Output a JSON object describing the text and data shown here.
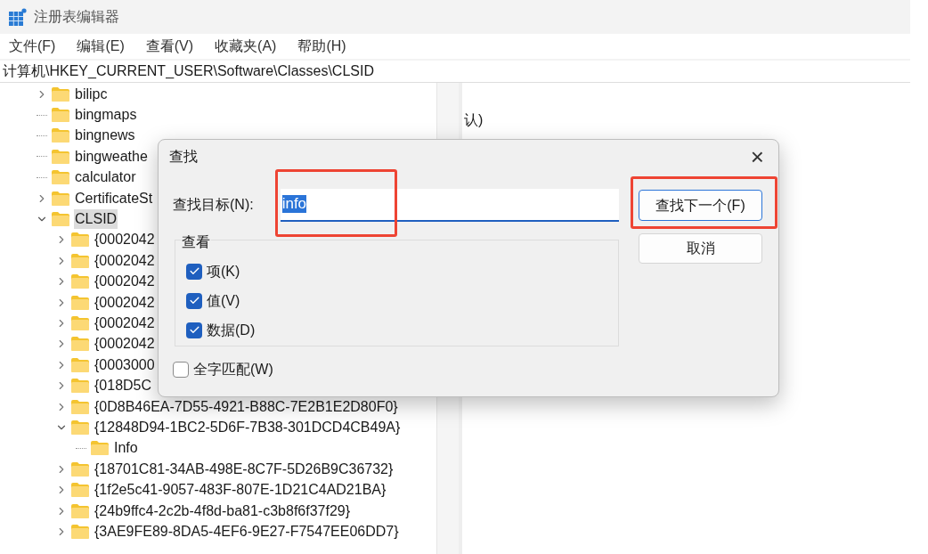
{
  "window": {
    "title": "注册表编辑器"
  },
  "menu": [
    "文件(F)",
    "编辑(E)",
    "查看(V)",
    "收藏夹(A)",
    "帮助(H)"
  ],
  "address": "计算机\\HKEY_CURRENT_USER\\Software\\Classes\\CLSID",
  "tree": [
    {
      "label": "bilipc",
      "kind": "branch",
      "expanded": false,
      "selected": false
    },
    {
      "label": "bingmaps",
      "kind": "leaf",
      "selected": false
    },
    {
      "label": "bingnews",
      "kind": "leaf",
      "selected": false
    },
    {
      "label": "bingweathe",
      "kind": "leaf",
      "selected": false
    },
    {
      "label": "calculator",
      "kind": "leaf",
      "selected": false
    },
    {
      "label": "CertificateSt",
      "kind": "branch",
      "expanded": false,
      "selected": false
    },
    {
      "label": "CLSID",
      "kind": "branch",
      "expanded": true,
      "selected": true,
      "children": [
        {
          "label": "{0002042",
          "kind": "branch",
          "expanded": false,
          "selected": false
        },
        {
          "label": "{0002042",
          "kind": "branch",
          "expanded": false,
          "selected": false
        },
        {
          "label": "{0002042",
          "kind": "branch",
          "expanded": false,
          "selected": false
        },
        {
          "label": "{0002042",
          "kind": "branch",
          "expanded": false,
          "selected": false
        },
        {
          "label": "{0002042",
          "kind": "branch",
          "expanded": false,
          "selected": false
        },
        {
          "label": "{0002042",
          "kind": "branch",
          "expanded": false,
          "selected": false
        },
        {
          "label": "{0003000",
          "kind": "branch",
          "expanded": false,
          "selected": false
        },
        {
          "label": "{018D5C",
          "kind": "branch",
          "expanded": false,
          "selected": false
        },
        {
          "label": "{0D8B46EA-7D55-4921-B88C-7E2B1E2D80F0}",
          "kind": "branch",
          "expanded": false,
          "selected": false
        },
        {
          "label": "{12848D94-1BC2-5D6F-7B38-301DCD4CB49A}",
          "kind": "branch",
          "expanded": true,
          "selected": false,
          "children": [
            {
              "label": "Info",
              "kind": "leaf",
              "selected": false
            }
          ]
        },
        {
          "label": "{18701C81-34AB-498E-8C7F-5D26B9C36732}",
          "kind": "branch",
          "expanded": false,
          "selected": false
        },
        {
          "label": "{1f2e5c41-9057-483F-807E-1D21C4AD21BA}",
          "kind": "branch",
          "expanded": false,
          "selected": false
        },
        {
          "label": "{24b9ffc4-2c2b-4f8d-ba81-c3b8f6f37f29}",
          "kind": "branch",
          "expanded": false,
          "selected": false
        },
        {
          "label": "{3AE9FE89-8DA5-4EF6-9E27-F7547EE06DD7}",
          "kind": "branch",
          "expanded": false,
          "selected": false
        }
      ]
    }
  ],
  "values_pane": {
    "column_1": "认)"
  },
  "dialog": {
    "title": "查找",
    "close": "×",
    "target_label": "查找目标(N):",
    "target_value": "info",
    "find_next": "查找下一个(F)",
    "cancel": "取消",
    "look_in": {
      "legend": "查看",
      "options": [
        {
          "label": "项(K)",
          "checked": true
        },
        {
          "label": "值(V)",
          "checked": true
        },
        {
          "label": "数据(D)",
          "checked": true
        }
      ]
    },
    "match_whole": {
      "label": "全字匹配(W)",
      "checked": false
    }
  }
}
